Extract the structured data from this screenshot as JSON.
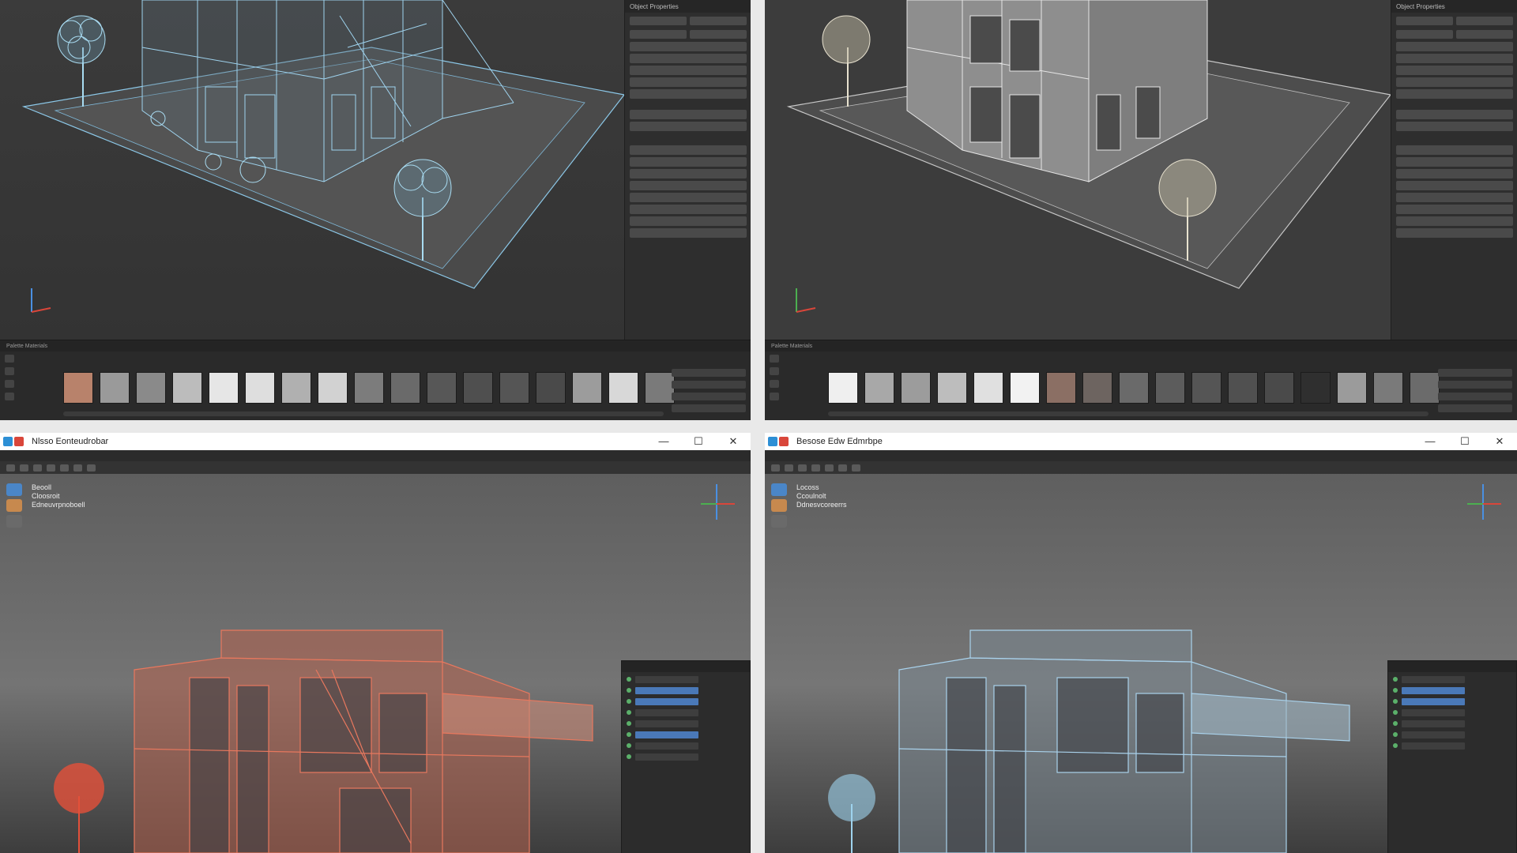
{
  "panels": [
    {
      "id": "top-left",
      "mode": "wireframe",
      "wire_color": "#9fd3ee",
      "sidepanel_label": "Object Properties",
      "strip_label": "Palette Materials",
      "swatches": [
        "#b8826b",
        "#9a9a9a",
        "#8a8a8a",
        "#bcbcbc",
        "#e6e6e6",
        "#dedede",
        "#b0b0b0",
        "#d2d2d2",
        "#7c7c7c",
        "#6a6a6a",
        "#575757",
        "#4f4f4f",
        "#555555",
        "#4a4a4a",
        "#9c9c9c",
        "#d8d8d8",
        "#7a7a7a"
      ]
    },
    {
      "id": "top-right",
      "mode": "solid",
      "wire_color": "#e6e6e6",
      "sidepanel_label": "Object Properties",
      "strip_label": "Palette Materials",
      "swatches": [
        "#efefef",
        "#a8a8a8",
        "#9c9c9c",
        "#bdbdbd",
        "#e0e0e0",
        "#f2f2f2",
        "#8b6f64",
        "#6d6460",
        "#6a6a6a",
        "#5c5c5c",
        "#555555",
        "#505050",
        "#4a4a4a",
        "#2f2f2f",
        "#9b9b9b",
        "#7a7a7a",
        "#6b6b6b"
      ]
    },
    {
      "id": "bottom-left",
      "window_title": "Nlsso Eonteudrobar",
      "info_lines": [
        "Beooll",
        "Cloosroit",
        "Edneuvrpnoboell"
      ],
      "wire_color": "#e8785e",
      "tree_color": "#e3503a"
    },
    {
      "id": "bottom-right",
      "window_title": "Besose Edw Edmrbpe",
      "info_lines": [
        "Locoss",
        "Ccoulnolt",
        "Ddnesvcoreerrs"
      ],
      "wire_color": "#a9d2ec",
      "tree_color": "#9fd3ee"
    }
  ],
  "window_buttons": {
    "minimize": "—",
    "maximize": "☐",
    "close": "✕"
  },
  "icons": [
    "app-icon",
    "minimize-icon",
    "maximize-icon",
    "close-icon",
    "axis-gizmo-icon",
    "tree-icon"
  ]
}
